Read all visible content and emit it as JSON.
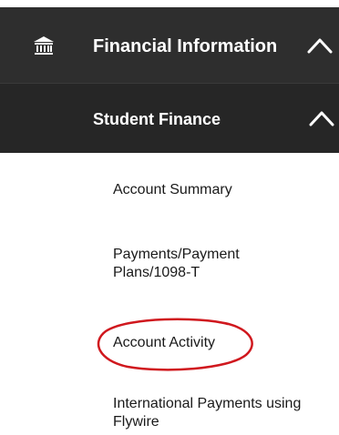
{
  "nav": {
    "financial_information": {
      "label": "Financial Information",
      "icon": "bank-icon",
      "expanded_icon": "chevron-up-icon"
    },
    "student_finance": {
      "label": "Student Finance",
      "expanded_icon": "chevron-up-icon"
    },
    "items": [
      {
        "label": "Account Summary"
      },
      {
        "label": "Payments/Payment Plans/1098-T"
      },
      {
        "label": "Account Activity"
      },
      {
        "label": "International Payments using Flywire"
      }
    ]
  },
  "colors": {
    "header_bg": "#2e2e2e",
    "subheader_bg": "#262626",
    "header_text": "#ffffff",
    "item_text": "#1a1a1a",
    "annotation": "#d0181e"
  }
}
